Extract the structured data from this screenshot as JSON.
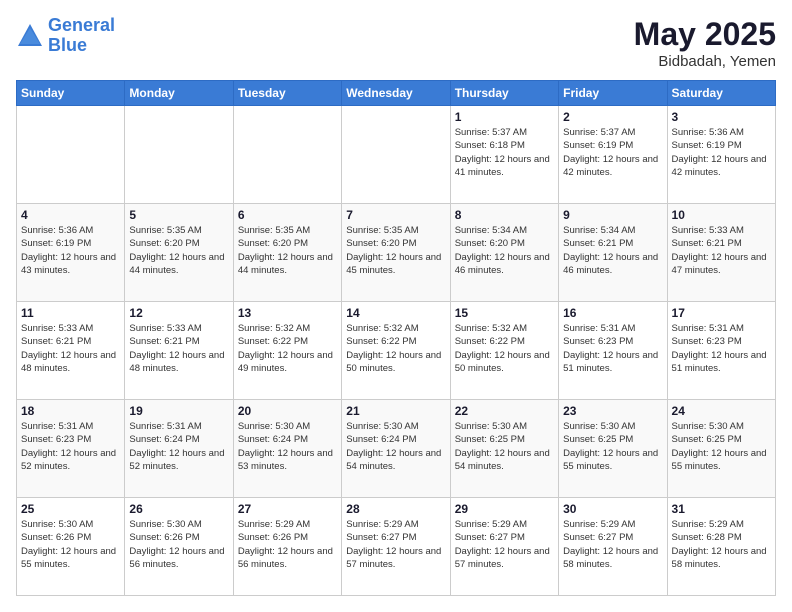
{
  "logo": {
    "line1": "General",
    "line2": "Blue"
  },
  "title": "May 2025",
  "subtitle": "Bidbadah, Yemen",
  "days_header": [
    "Sunday",
    "Monday",
    "Tuesday",
    "Wednesday",
    "Thursday",
    "Friday",
    "Saturday"
  ],
  "weeks": [
    [
      {
        "day": "",
        "empty": true
      },
      {
        "day": "",
        "empty": true
      },
      {
        "day": "",
        "empty": true
      },
      {
        "day": "",
        "empty": true
      },
      {
        "day": "1",
        "rise": "5:37 AM",
        "set": "6:18 PM",
        "daylight": "12 hours and 41 minutes."
      },
      {
        "day": "2",
        "rise": "5:37 AM",
        "set": "6:19 PM",
        "daylight": "12 hours and 42 minutes."
      },
      {
        "day": "3",
        "rise": "5:36 AM",
        "set": "6:19 PM",
        "daylight": "12 hours and 42 minutes."
      }
    ],
    [
      {
        "day": "4",
        "rise": "5:36 AM",
        "set": "6:19 PM",
        "daylight": "12 hours and 43 minutes."
      },
      {
        "day": "5",
        "rise": "5:35 AM",
        "set": "6:20 PM",
        "daylight": "12 hours and 44 minutes."
      },
      {
        "day": "6",
        "rise": "5:35 AM",
        "set": "6:20 PM",
        "daylight": "12 hours and 44 minutes."
      },
      {
        "day": "7",
        "rise": "5:35 AM",
        "set": "6:20 PM",
        "daylight": "12 hours and 45 minutes."
      },
      {
        "day": "8",
        "rise": "5:34 AM",
        "set": "6:20 PM",
        "daylight": "12 hours and 46 minutes."
      },
      {
        "day": "9",
        "rise": "5:34 AM",
        "set": "6:21 PM",
        "daylight": "12 hours and 46 minutes."
      },
      {
        "day": "10",
        "rise": "5:33 AM",
        "set": "6:21 PM",
        "daylight": "12 hours and 47 minutes."
      }
    ],
    [
      {
        "day": "11",
        "rise": "5:33 AM",
        "set": "6:21 PM",
        "daylight": "12 hours and 48 minutes."
      },
      {
        "day": "12",
        "rise": "5:33 AM",
        "set": "6:21 PM",
        "daylight": "12 hours and 48 minutes."
      },
      {
        "day": "13",
        "rise": "5:32 AM",
        "set": "6:22 PM",
        "daylight": "12 hours and 49 minutes."
      },
      {
        "day": "14",
        "rise": "5:32 AM",
        "set": "6:22 PM",
        "daylight": "12 hours and 50 minutes."
      },
      {
        "day": "15",
        "rise": "5:32 AM",
        "set": "6:22 PM",
        "daylight": "12 hours and 50 minutes."
      },
      {
        "day": "16",
        "rise": "5:31 AM",
        "set": "6:23 PM",
        "daylight": "12 hours and 51 minutes."
      },
      {
        "day": "17",
        "rise": "5:31 AM",
        "set": "6:23 PM",
        "daylight": "12 hours and 51 minutes."
      }
    ],
    [
      {
        "day": "18",
        "rise": "5:31 AM",
        "set": "6:23 PM",
        "daylight": "12 hours and 52 minutes."
      },
      {
        "day": "19",
        "rise": "5:31 AM",
        "set": "6:24 PM",
        "daylight": "12 hours and 52 minutes."
      },
      {
        "day": "20",
        "rise": "5:30 AM",
        "set": "6:24 PM",
        "daylight": "12 hours and 53 minutes."
      },
      {
        "day": "21",
        "rise": "5:30 AM",
        "set": "6:24 PM",
        "daylight": "12 hours and 54 minutes."
      },
      {
        "day": "22",
        "rise": "5:30 AM",
        "set": "6:25 PM",
        "daylight": "12 hours and 54 minutes."
      },
      {
        "day": "23",
        "rise": "5:30 AM",
        "set": "6:25 PM",
        "daylight": "12 hours and 55 minutes."
      },
      {
        "day": "24",
        "rise": "5:30 AM",
        "set": "6:25 PM",
        "daylight": "12 hours and 55 minutes."
      }
    ],
    [
      {
        "day": "25",
        "rise": "5:30 AM",
        "set": "6:26 PM",
        "daylight": "12 hours and 55 minutes."
      },
      {
        "day": "26",
        "rise": "5:30 AM",
        "set": "6:26 PM",
        "daylight": "12 hours and 56 minutes."
      },
      {
        "day": "27",
        "rise": "5:29 AM",
        "set": "6:26 PM",
        "daylight": "12 hours and 56 minutes."
      },
      {
        "day": "28",
        "rise": "5:29 AM",
        "set": "6:27 PM",
        "daylight": "12 hours and 57 minutes."
      },
      {
        "day": "29",
        "rise": "5:29 AM",
        "set": "6:27 PM",
        "daylight": "12 hours and 57 minutes."
      },
      {
        "day": "30",
        "rise": "5:29 AM",
        "set": "6:27 PM",
        "daylight": "12 hours and 58 minutes."
      },
      {
        "day": "31",
        "rise": "5:29 AM",
        "set": "6:28 PM",
        "daylight": "12 hours and 58 minutes."
      }
    ]
  ]
}
